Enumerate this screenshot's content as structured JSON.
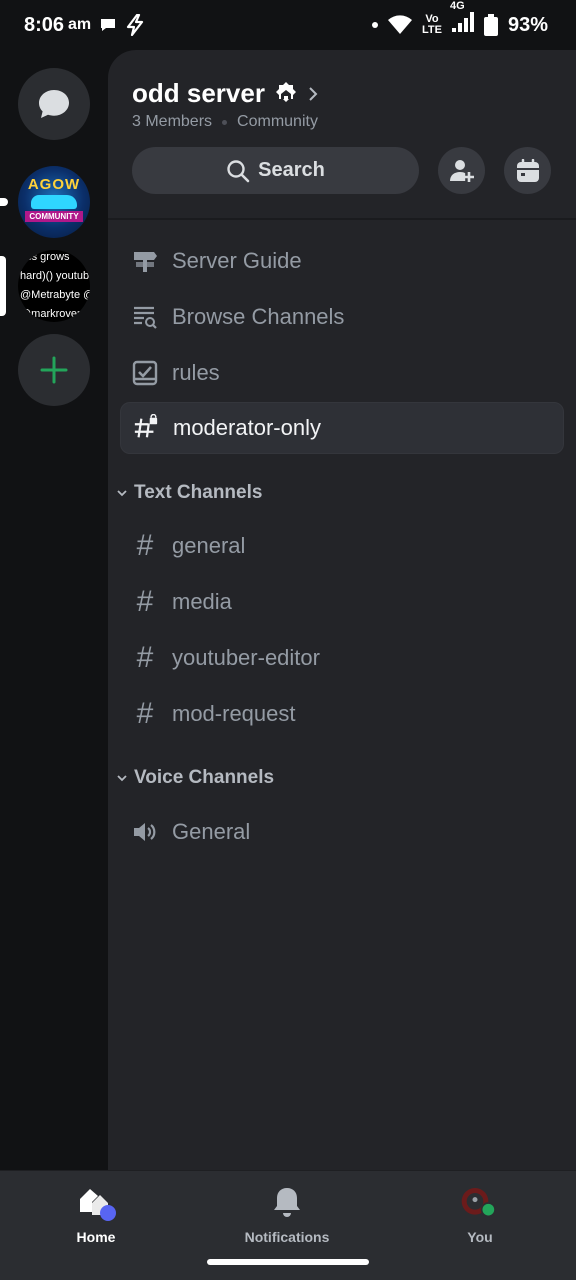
{
  "status_bar": {
    "time": "8:06",
    "ampm": "am",
    "network_top": "Vo",
    "network_bottom": "LTE",
    "network_gen": "4G",
    "battery": "93%"
  },
  "rail": {
    "servers": [
      {
        "name": "AGOW",
        "caption": "COMMUNITY"
      },
      {
        "lines": [
          "ess grows",
          "hard)() youtub",
          "@Metrabyte @",
          "@markrover @"
        ]
      }
    ]
  },
  "server": {
    "name": "odd server",
    "members": "3 Members",
    "type": "Community"
  },
  "search": {
    "label": "Search"
  },
  "channels_top": [
    {
      "label": "Server Guide",
      "icon": "signpost-icon"
    },
    {
      "label": "Browse Channels",
      "icon": "browse-icon"
    },
    {
      "label": "rules",
      "icon": "rules-checkbox-icon"
    },
    {
      "label": "moderator-only",
      "icon": "locked-hash-icon"
    }
  ],
  "categories": {
    "text": "Text Channels",
    "voice": "Voice Channels"
  },
  "text_channels": [
    "general",
    "media",
    "youtuber-editor",
    "mod-request"
  ],
  "voice_channels": [
    "General"
  ],
  "nav": {
    "home": "Home",
    "notifications": "Notifications",
    "you": "You"
  },
  "colors": {
    "accent_blurple": "#5865f2",
    "online_green": "#23a55a",
    "add_green": "#23a55a"
  }
}
